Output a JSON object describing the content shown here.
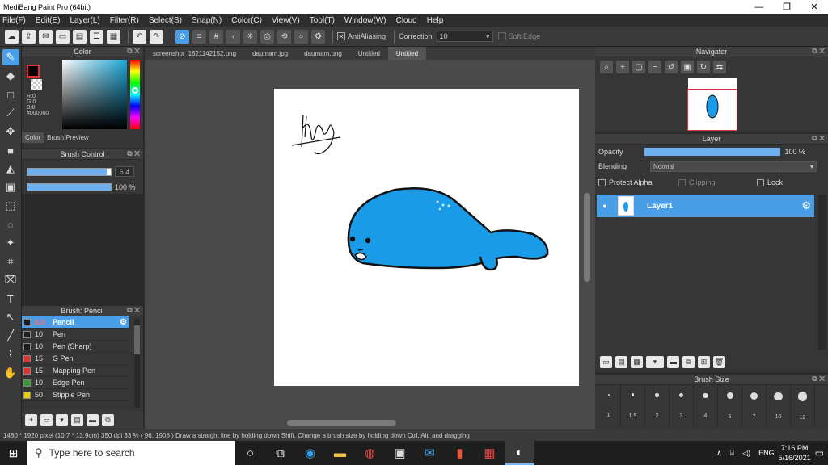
{
  "window": {
    "title": "MediBang Paint Pro (64bit)",
    "controls": [
      "—",
      "❐",
      "✕"
    ]
  },
  "menu": [
    "File(F)",
    "Edit(E)",
    "Layer(L)",
    "Filter(R)",
    "Select(S)",
    "Snap(N)",
    "Color(C)",
    "View(V)",
    "Tool(T)",
    "Window(W)",
    "Cloud",
    "Help"
  ],
  "toolbar": {
    "antialiasing_label": "AntiAliasing",
    "correction_label": "Correction",
    "correction_value": "10",
    "soft_edge_label": "Soft Edge"
  },
  "color_panel": {
    "title": "Color",
    "rgb": [
      "R:0",
      "G:0",
      "B:0",
      "#000000"
    ],
    "tabs": [
      "Color",
      "Brush Preview"
    ]
  },
  "brush_control": {
    "title": "Brush Control",
    "size_value": "6.4",
    "opacity_label": "100 %",
    "size_fraction": 0.95,
    "opacity_fraction": 1.0
  },
  "brush_list": {
    "title": "Brush: Pencil",
    "items": [
      {
        "size": "6.4",
        "name": "Pencil",
        "color": "#1e1e1e",
        "active": true
      },
      {
        "size": "10",
        "name": "Pen",
        "color": "#1e1e1e"
      },
      {
        "size": "10",
        "name": "Pen (Sharp)",
        "color": "#1e1e1e"
      },
      {
        "size": "15",
        "name": "G Pen",
        "color": "#e53030"
      },
      {
        "size": "15",
        "name": "Mapping Pen",
        "color": "#e53030"
      },
      {
        "size": "10",
        "name": "Edge Pen",
        "color": "#2ca02c"
      },
      {
        "size": "50",
        "name": "Stipple Pen",
        "color": "#e8d000"
      }
    ]
  },
  "tabs": [
    "screenshot_1621142152.png",
    "daumam.jpg",
    "daumam.png",
    "Untitled",
    "Untitled"
  ],
  "active_tab_index": 4,
  "navigator": {
    "title": "Navigator"
  },
  "layer_panel": {
    "title": "Layer",
    "opacity_label": "Opacity",
    "opacity_value": "100 %",
    "blending_label": "Blending",
    "blending_value": "Normal",
    "protect_alpha_label": "Protect Alpha",
    "clipping_label": "Clipping",
    "lock_label": "Lock",
    "layers": [
      {
        "name": "Layer1"
      }
    ]
  },
  "brush_size": {
    "title": "Brush Size",
    "sizes": [
      "1",
      "1.5",
      "2",
      "3",
      "4",
      "5",
      "7",
      "10",
      "12"
    ]
  },
  "status": {
    "text": "1480 * 1920 pixel  (10.7 * 13.9cm)  350 dpi  33 %  ( 96, 1908 )  Draw a straight line by holding down Shift, Change a brush size by holding down Ctrl, Alt, and dragging"
  },
  "taskbar": {
    "search_placeholder": "Type here to search",
    "lang": "ENG",
    "time": "7:16 PM",
    "date": "5/16/2021"
  },
  "colors": {
    "accent": "#4a9ee8",
    "seal_fill": "#1a9be8"
  }
}
